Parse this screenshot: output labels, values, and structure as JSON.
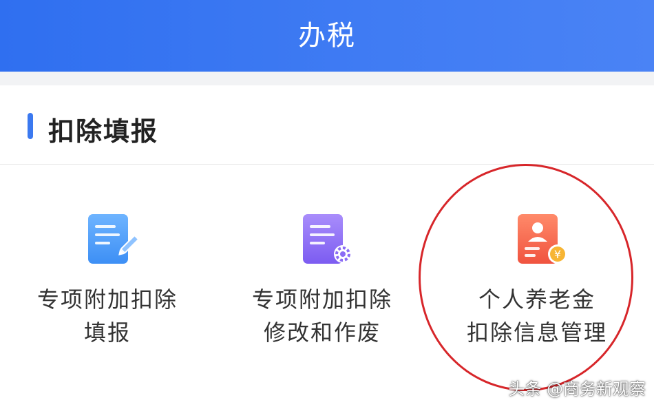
{
  "header": {
    "title": "办税"
  },
  "section": {
    "title": "扣除填报"
  },
  "items": [
    {
      "line1": "专项附加扣除",
      "line2": "填报",
      "icon": "document-edit-icon"
    },
    {
      "line1": "专项附加扣除",
      "line2": "修改和作废",
      "icon": "document-settings-icon"
    },
    {
      "line1": "个人养老金",
      "line2": "扣除信息管理",
      "icon": "pension-profile-icon"
    }
  ],
  "watermark": "头条 @商务新观察",
  "colors": {
    "header_blue": "#3b79f0",
    "highlight_circle": "#d7262a"
  }
}
